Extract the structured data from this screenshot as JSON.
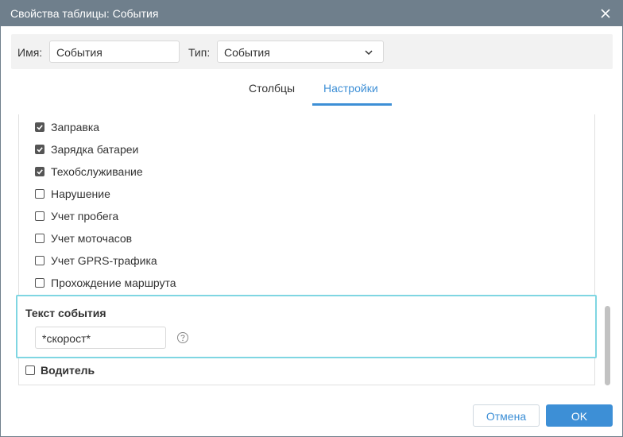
{
  "window": {
    "title": "Свойства таблицы: События"
  },
  "form": {
    "name_label": "Имя:",
    "name_value": "События",
    "type_label": "Тип:",
    "type_value": "События"
  },
  "tabs": [
    {
      "label": "Столбцы",
      "active": false
    },
    {
      "label": "Настройки",
      "active": true
    }
  ],
  "event_types": [
    {
      "label": "Заправка",
      "checked": true
    },
    {
      "label": "Зарядка батареи",
      "checked": true
    },
    {
      "label": "Техобслуживание",
      "checked": true
    },
    {
      "label": "Нарушение",
      "checked": false
    },
    {
      "label": "Учет пробега",
      "checked": false
    },
    {
      "label": "Учет моточасов",
      "checked": false
    },
    {
      "label": "Учет GPRS-трафика",
      "checked": false
    },
    {
      "label": "Прохождение маршрута",
      "checked": false
    }
  ],
  "event_text": {
    "title": "Текст события",
    "value": "*скорост*"
  },
  "driver": {
    "label": "Водитель",
    "checked": false
  },
  "buttons": {
    "cancel": "Отмена",
    "ok": "OK"
  },
  "colors": {
    "accent": "#3d8fd6",
    "titlebar": "#6f7f8c",
    "highlight_border": "#7fd6e2"
  },
  "icons": {
    "close": "close-icon",
    "chevron": "chevron-down-icon",
    "help": "help-icon",
    "check": "check-icon"
  }
}
